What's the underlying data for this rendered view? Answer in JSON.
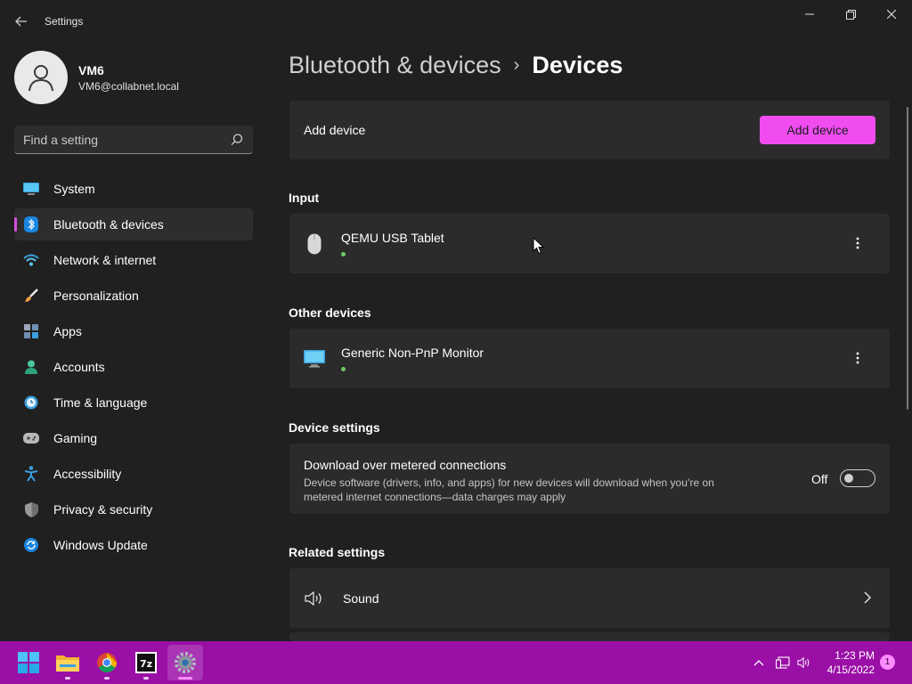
{
  "window": {
    "title": "Settings"
  },
  "profile": {
    "name": "VM6",
    "email": "VM6@collabnet.local"
  },
  "search": {
    "placeholder": "Find a setting"
  },
  "sidebar": {
    "items": [
      {
        "label": "System",
        "icon": "system-icon"
      },
      {
        "label": "Bluetooth & devices",
        "icon": "bluetooth-icon",
        "active": true
      },
      {
        "label": "Network & internet",
        "icon": "wifi-icon"
      },
      {
        "label": "Personalization",
        "icon": "brush-icon"
      },
      {
        "label": "Apps",
        "icon": "apps-icon"
      },
      {
        "label": "Accounts",
        "icon": "person-icon"
      },
      {
        "label": "Time & language",
        "icon": "clock-globe-icon"
      },
      {
        "label": "Gaming",
        "icon": "gamepad-icon"
      },
      {
        "label": "Accessibility",
        "icon": "accessibility-icon"
      },
      {
        "label": "Privacy & security",
        "icon": "shield-icon"
      },
      {
        "label": "Windows Update",
        "icon": "update-icon"
      }
    ]
  },
  "breadcrumb": {
    "parent": "Bluetooth & devices",
    "separator": "›",
    "current": "Devices"
  },
  "add_device": {
    "label": "Add device",
    "button": "Add device"
  },
  "input": {
    "title": "Input",
    "devices": [
      {
        "name": "QEMU USB Tablet",
        "icon": "mouse-icon",
        "status": "connected"
      }
    ]
  },
  "other_devices": {
    "title": "Other devices",
    "devices": [
      {
        "name": "Generic Non-PnP Monitor",
        "icon": "monitor-icon",
        "status": "connected"
      }
    ]
  },
  "device_settings": {
    "title": "Device settings",
    "metered": {
      "title": "Download over metered connections",
      "description": "Device software (drivers, info, and apps) for new devices will download when you’re on metered internet connections—data charges may apply",
      "state_label": "Off",
      "enabled": false
    }
  },
  "related_settings": {
    "title": "Related settings",
    "items": [
      {
        "label": "Sound",
        "icon": "speaker-icon"
      }
    ]
  },
  "taskbar": {
    "apps": [
      "start-icon",
      "file-explorer-icon",
      "chrome-icon",
      "7zip-icon",
      "settings-icon"
    ],
    "active_app": "settings-icon",
    "time": "1:23 PM",
    "date": "4/15/2022",
    "notification_count": "1"
  },
  "colors": {
    "accent": "#f04cf0",
    "taskbar": "#9a0fa6",
    "background": "#202020",
    "card": "#2b2b2b",
    "status_green": "#6ccb5f"
  }
}
